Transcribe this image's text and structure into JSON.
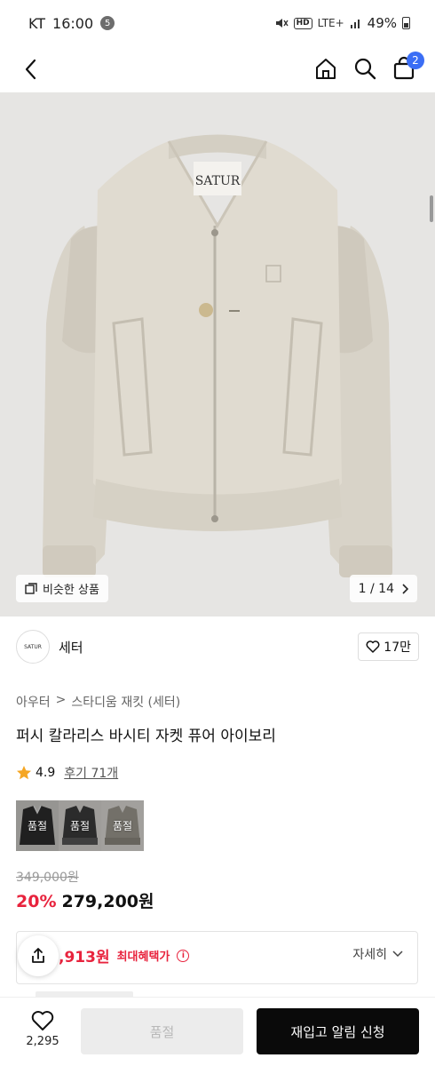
{
  "status_bar": {
    "carrier": "KT",
    "time": "16:00",
    "notification_count": "5",
    "hd": "HD",
    "network": "LTE+",
    "battery": "49%"
  },
  "nav": {
    "cart_count": "2"
  },
  "gallery": {
    "similar_label": "비슷한 상품",
    "page_indicator": "1 / 14",
    "garment_label": "SATUR",
    "colors": {
      "background": "#e6e5e3",
      "garment": "#ddd8cc"
    }
  },
  "brand": {
    "logo_text": "SATUR",
    "name": "세터",
    "like_count": "17만"
  },
  "breadcrumb": {
    "category": "아우터",
    "separator": ">",
    "subcategory": "스타디움 재킷 (세터)"
  },
  "product": {
    "title": "퍼시 칼라리스 바시티 자켓 퓨어 아이보리"
  },
  "rating": {
    "score": "4.9",
    "review_link": "후기 71개"
  },
  "options": [
    {
      "label": "품절",
      "swatch": "#2b2b2b"
    },
    {
      "label": "품절",
      "swatch": "#3a3a3a"
    },
    {
      "label": "품절",
      "swatch": "#9a968c"
    }
  ],
  "price": {
    "original": "349,000원",
    "discount": "20%",
    "sale": "279,200원",
    "accent": "#e8233d"
  },
  "benefit": {
    "price": ",913원",
    "label": "최대혜택가",
    "info_glyph": "i",
    "detail_label": "자세히"
  },
  "bottom": {
    "wish_count": "2,295",
    "soldout_label": "품절",
    "restock_label": "재입고 알림 신청"
  }
}
